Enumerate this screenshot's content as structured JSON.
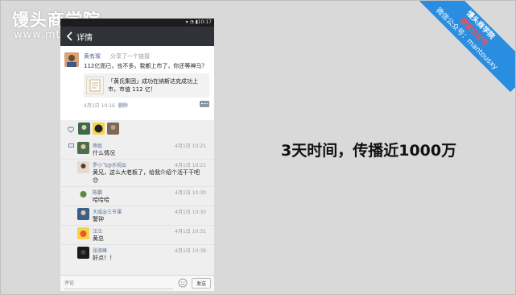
{
  "watermark": {
    "title": "馒头商学院",
    "url": "www.mtedu.com"
  },
  "corner_ribbon": {
    "line1": "馒头商学院",
    "line2": "搜索公众号",
    "line3": "微信公众号：mantousxy"
  },
  "headline": "3天时间，传播近1000万",
  "phone": {
    "status_time": "10:17",
    "title": "详情",
    "post": {
      "author": "黄有璨",
      "action": "分享了一个链接",
      "text": "112亿而已，也不多，我都上市了，你还等神马？",
      "link_text": "「黄氏集团」成功在纳斯达克成功上市，市值 112 亿！",
      "time": "4月1日 10:16",
      "delete_label": "删除"
    },
    "comments": [
      {
        "name": "蒋姐",
        "time": "4月1日 10:21",
        "text": "什么情况"
      },
      {
        "name": "罗小飞@乐视云",
        "time": "4月1日 10:21",
        "text": "黄兄，这么大老板了，给我介绍个活干干吧😊"
      },
      {
        "name": "陈鹏",
        "time": "4月1日 10:30",
        "text": "哈哈哈"
      },
      {
        "name": "大成@三节课",
        "time": "4月1日 10:30",
        "text": "警钟"
      },
      {
        "name": "汪汪",
        "time": "4月1日 10:31",
        "text": "黄总"
      },
      {
        "name": "张淑峰",
        "time": "4月1日 10:39",
        "text": "好点！！"
      }
    ],
    "input_placeholder": "评论",
    "send_label": "发送"
  },
  "colors": {
    "background": "#d9d9d9",
    "ribbon": "#2a8ee0",
    "link_blue": "#576b95",
    "titlebar": "#2f3236"
  }
}
